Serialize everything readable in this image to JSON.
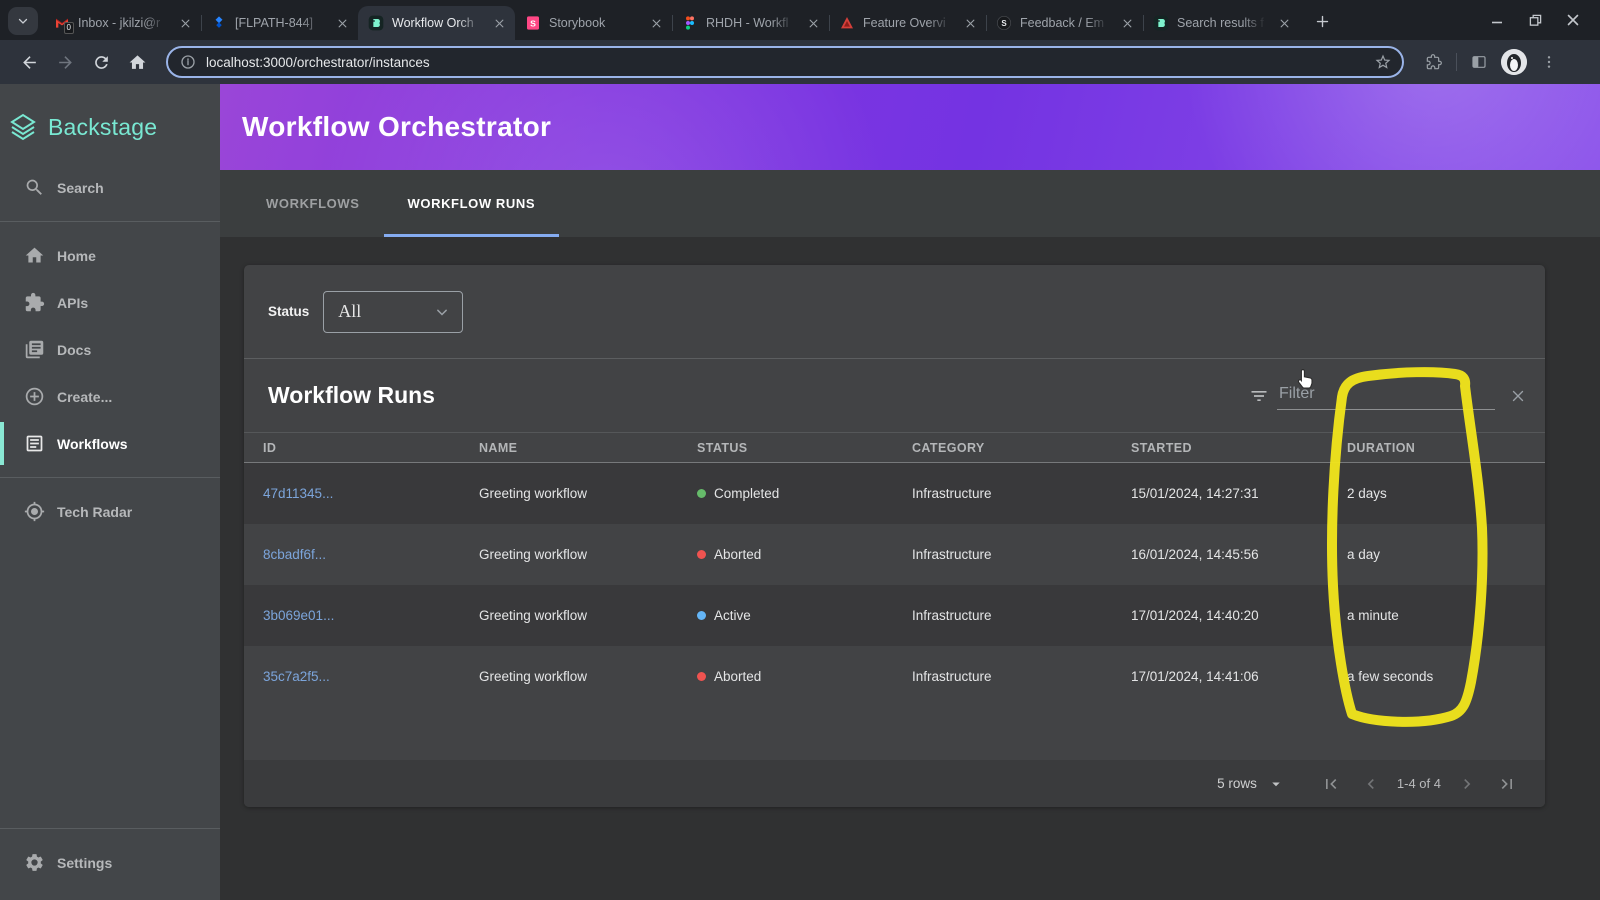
{
  "browser": {
    "tabs": [
      {
        "title": "Inbox - jkilzi@r",
        "icon": "gmail",
        "active": false
      },
      {
        "title": "[FLPATH-844]",
        "icon": "jira",
        "active": false
      },
      {
        "title": "Workflow Orch",
        "icon": "backstage",
        "active": true
      },
      {
        "title": "Storybook",
        "icon": "storybook",
        "active": false
      },
      {
        "title": "RHDH - Workfl",
        "icon": "figma",
        "active": false
      },
      {
        "title": "Feature Overvi",
        "icon": "feature",
        "active": false
      },
      {
        "title": "Feedback / Em",
        "icon": "feedback",
        "active": false
      },
      {
        "title": "Search results f",
        "icon": "backstage",
        "active": false
      }
    ],
    "gmail_badge": "0",
    "url": "localhost:3000/orchestrator/instances"
  },
  "sidebar": {
    "brand": "Backstage",
    "groups": [
      {
        "items": [
          {
            "label": "Search",
            "icon": "search",
            "active": false
          }
        ]
      },
      {
        "items": [
          {
            "label": "Home",
            "icon": "home",
            "active": false
          },
          {
            "label": "APIs",
            "icon": "apis",
            "active": false
          },
          {
            "label": "Docs",
            "icon": "docs",
            "active": false
          },
          {
            "label": "Create...",
            "icon": "create",
            "active": false
          },
          {
            "label": "Workflows",
            "icon": "workflows",
            "active": true
          }
        ]
      },
      {
        "items": [
          {
            "label": "Tech Radar",
            "icon": "tech-radar",
            "active": false
          }
        ]
      }
    ],
    "settings": {
      "label": "Settings",
      "icon": "settings"
    }
  },
  "header": {
    "title": "Workflow Orchestrator"
  },
  "page_tabs": [
    {
      "label": "WORKFLOWS",
      "active": false
    },
    {
      "label": "WORKFLOW RUNS",
      "active": true
    }
  ],
  "filters": {
    "status_label": "Status",
    "status_value": "All"
  },
  "table": {
    "title": "Workflow Runs",
    "filter_placeholder": "Filter",
    "columns": [
      "ID",
      "NAME",
      "STATUS",
      "CATEGORY",
      "STARTED",
      "DURATION"
    ],
    "status_colors": {
      "Completed": "#66bb6a",
      "Aborted": "#ef5350",
      "Active": "#64b5f6"
    },
    "rows": [
      {
        "id": "47d11345...",
        "name": "Greeting workflow",
        "status": "Completed",
        "category": "Infrastructure",
        "started": "15/01/2024, 14:27:31",
        "duration": "2 days"
      },
      {
        "id": "8cbadf6f...",
        "name": "Greeting workflow",
        "status": "Aborted",
        "category": "Infrastructure",
        "started": "16/01/2024, 14:45:56",
        "duration": "a day"
      },
      {
        "id": "3b069e01...",
        "name": "Greeting workflow",
        "status": "Active",
        "category": "Infrastructure",
        "started": "17/01/2024, 14:40:20",
        "duration": "a minute"
      },
      {
        "id": "35c7a2f5...",
        "name": "Greeting workflow",
        "status": "Aborted",
        "category": "Infrastructure",
        "started": "17/01/2024, 14:41:06",
        "duration": "a few seconds"
      }
    ]
  },
  "pagination": {
    "rows_per_page": "5 rows",
    "range_label": "1-4 of 4"
  },
  "annotation": {
    "shape": "hand-drawn-loop",
    "target": "duration-column",
    "color": "#f0e41c"
  }
}
